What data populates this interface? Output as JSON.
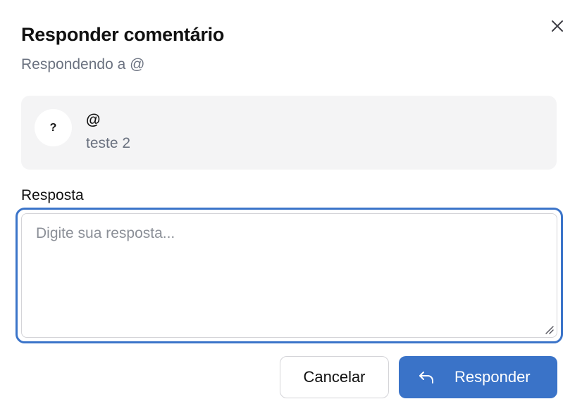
{
  "dialog": {
    "title": "Responder comentário",
    "subtitle": "Respondendo a @",
    "close_icon": "close-icon"
  },
  "comment": {
    "avatar_text": "?",
    "author": "@",
    "text": "teste 2"
  },
  "reply": {
    "label": "Resposta",
    "value": "",
    "placeholder": "Digite sua resposta..."
  },
  "actions": {
    "cancel_label": "Cancelar",
    "submit_label": "Responder",
    "submit_icon": "reply-arrow-icon"
  },
  "colors": {
    "accent": "#3a73c8",
    "focus_ring": "#3b74c9",
    "card_bg": "#f4f4f5",
    "muted_text": "#6b7280"
  }
}
